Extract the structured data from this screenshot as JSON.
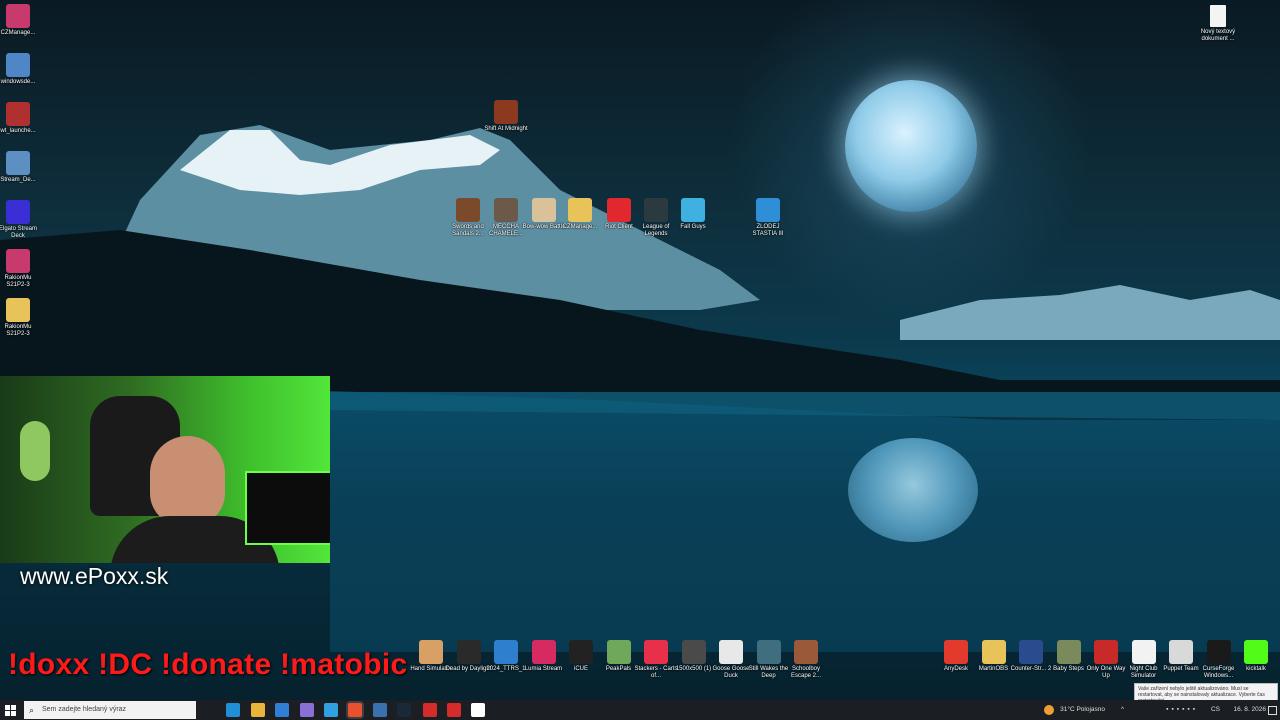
{
  "left_icons": [
    {
      "label": "CZManage...",
      "color": "#c83a6d",
      "icon": "winrar-archive-icon"
    },
    {
      "label": "windowsde...",
      "color": "#4f86c6",
      "icon": "installer-icon"
    },
    {
      "label": "wt_launche...",
      "color": "#b02f2f",
      "icon": "war-thunder-icon"
    },
    {
      "label": "Stream_De...",
      "color": "#5d8fc2",
      "icon": "installer-icon"
    },
    {
      "label": "Elgato Stream Deck",
      "color": "#3a2fd4",
      "icon": "stream-deck-icon"
    },
    {
      "label": "RakionMu S21P2-3",
      "color": "#c83a6d",
      "icon": "winrar-archive-icon"
    },
    {
      "label": "RakionMu S21P2-3",
      "color": "#e8c35a",
      "icon": "folder-icon"
    }
  ],
  "top_right_icon": {
    "label": "Nový textový dokument ...",
    "icon": "text-document-icon"
  },
  "center_icons": [
    {
      "label": "Shift At Midnight",
      "color": "#8b3a1f"
    },
    {
      "label": "Swords and Sandals 2...",
      "color": "#7a4a2a"
    },
    {
      "label": "MECCHA CHAMELE...",
      "color": "#6b5a4a"
    },
    {
      "label": "Bow-wow Battle",
      "color": "#d9c29a"
    },
    {
      "label": "CZManage...",
      "color": "#e8c35a"
    },
    {
      "label": "Riot Client",
      "color": "#e0282e"
    },
    {
      "label": "League of Legends",
      "color": "#2b3a3f"
    },
    {
      "label": "Fall Guys",
      "color": "#3fb1e0"
    },
    {
      "label": "ZLODEJ STASTIA III",
      "color": "#2f8fd6"
    }
  ],
  "bottom_icons": [
    {
      "label": "Hand Simulator",
      "color": "#d9a066"
    },
    {
      "label": "Dead by Daylight",
      "color": "#2a2a2a"
    },
    {
      "label": "2024_TTRS_1",
      "color": "#2f7fcf"
    },
    {
      "label": "Lumia Stream",
      "color": "#d62b62"
    },
    {
      "label": "iCUE",
      "color": "#222"
    },
    {
      "label": "PeakPals",
      "color": "#6fa85a"
    },
    {
      "label": "Stackers - Carts of...",
      "color": "#e8304a"
    },
    {
      "label": "1500x500 (1)",
      "color": "#4a4a4a"
    },
    {
      "label": "Goose Goose Duck",
      "color": "#e8e8e8"
    },
    {
      "label": "Still Wakes the Deep",
      "color": "#3f6f7f"
    },
    {
      "label": "Schoolboy Escape 2...",
      "color": "#9a5a3a"
    }
  ],
  "bottom_right_icons": [
    {
      "label": "AnyDesk",
      "color": "#e23b2e"
    },
    {
      "label": "MartinOBS",
      "color": "#e8c35a"
    },
    {
      "label": "Counter-Str... 2",
      "color": "#2b4b8f"
    },
    {
      "label": "Baby Steps",
      "color": "#7a8a5a"
    },
    {
      "label": "Only One Way Up",
      "color": "#c82a2a"
    },
    {
      "label": "Night Club Simulator",
      "color": "#f2f2f2"
    },
    {
      "label": "Puppet Team",
      "color": "#d9d9d9"
    },
    {
      "label": "CurseForge Windows...",
      "color": "#1a1a1a"
    },
    {
      "label": "kicktalk",
      "color": "#53fc18"
    }
  ],
  "overlay": {
    "website": "www.ePoxx.sk",
    "commands": "!doxx  !DC !donate !matobic"
  },
  "taskbar": {
    "search_placeholder": "Sem zadejte hledaný výraz",
    "weather": "31°C  Polojasno",
    "language": "CS",
    "date": "16. 8. 2026",
    "pinned": [
      {
        "icon": "task-view-icon",
        "color": "#1b1f24"
      },
      {
        "icon": "edge-icon",
        "color": "#1f8fd6"
      },
      {
        "icon": "file-explorer-icon",
        "color": "#e8b53a"
      },
      {
        "icon": "store-icon",
        "color": "#2f7fd6"
      },
      {
        "icon": "app-icon",
        "color": "#8a6fd6"
      },
      {
        "icon": "app-icon",
        "color": "#2fa0e0"
      },
      {
        "icon": "brave-icon",
        "color": "#e8502e"
      },
      {
        "icon": "app-icon",
        "color": "#3a6fb0"
      },
      {
        "icon": "steam-icon",
        "color": "#1b2838"
      },
      {
        "icon": "app-icon",
        "color": "#d62b2b"
      },
      {
        "icon": "app-icon",
        "color": "#d62b2b"
      },
      {
        "icon": "app-icon",
        "color": "#ffffff"
      }
    ]
  },
  "notification": {
    "text": "Vaše zařízení nebylo ještě aktualizováno. Musí se restartovat, aby se nainstalovaly aktualizace. Vyberte čas restartování."
  }
}
